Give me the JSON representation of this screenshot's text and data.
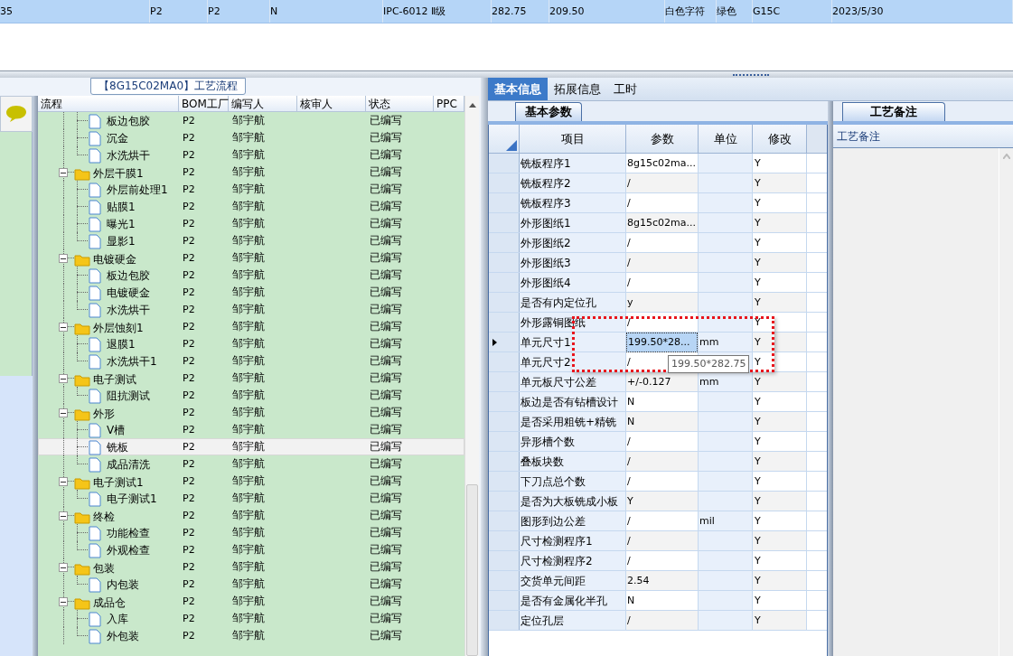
{
  "top_row": {
    "selected": true,
    "cells": [
      "35",
      "P2",
      "P2",
      "N",
      "IPC-6012 Ⅱ级",
      "282.75",
      "209.50",
      "白色字符",
      "绿色",
      "G15C",
      "2023/5/30"
    ]
  },
  "process": {
    "title": "【8G15C02MA0】工艺流程",
    "columns": [
      "流程",
      "BOM工厂",
      "编写人",
      "核审人",
      "状态",
      "PPC"
    ],
    "rows": [
      {
        "children": [
          {
            "name": "板边包胶",
            "bom": "P2",
            "author": "邹宇航",
            "status": "已编写",
            "selected": false
          },
          {
            "name": "沉金",
            "bom": "P2",
            "author": "邹宇航",
            "status": "已编写",
            "selected": false
          },
          {
            "name": "水洗烘干",
            "bom": "P2",
            "author": "邹宇航",
            "status": "已编写",
            "selected": false
          }
        ]
      },
      {
        "name": "外层干膜1",
        "bom": "P2",
        "author": "邹宇航",
        "status": "已编写",
        "selected": false,
        "expanded": true,
        "children": [
          {
            "name": "外层前处理1",
            "bom": "P2",
            "author": "邹宇航",
            "status": "已编写",
            "selected": false
          },
          {
            "name": "贴膜1",
            "bom": "P2",
            "author": "邹宇航",
            "status": "已编写",
            "selected": false
          },
          {
            "name": "曝光1",
            "bom": "P2",
            "author": "邹宇航",
            "status": "已编写",
            "selected": false
          },
          {
            "name": "显影1",
            "bom": "P2",
            "author": "邹宇航",
            "status": "已编写",
            "selected": false
          }
        ]
      },
      {
        "name": "电镀硬金",
        "bom": "P2",
        "author": "邹宇航",
        "status": "已编写",
        "selected": false,
        "expanded": true,
        "children": [
          {
            "name": "板边包胶",
            "bom": "P2",
            "author": "邹宇航",
            "status": "已编写",
            "selected": false
          },
          {
            "name": "电镀硬金",
            "bom": "P2",
            "author": "邹宇航",
            "status": "已编写",
            "selected": false
          },
          {
            "name": "水洗烘干",
            "bom": "P2",
            "author": "邹宇航",
            "status": "已编写",
            "selected": false
          }
        ]
      },
      {
        "name": "外层蚀刻1",
        "bom": "P2",
        "author": "邹宇航",
        "status": "已编写",
        "selected": false,
        "expanded": true,
        "children": [
          {
            "name": "退膜1",
            "bom": "P2",
            "author": "邹宇航",
            "status": "已编写",
            "selected": false
          },
          {
            "name": "水洗烘干1",
            "bom": "P2",
            "author": "邹宇航",
            "status": "已编写",
            "selected": false
          }
        ]
      },
      {
        "name": "电子测试",
        "bom": "P2",
        "author": "邹宇航",
        "status": "已编写",
        "selected": false,
        "expanded": true,
        "children": [
          {
            "name": "阻抗测试",
            "bom": "P2",
            "author": "邹宇航",
            "status": "已编写",
            "selected": false
          }
        ]
      },
      {
        "name": "外形",
        "bom": "P2",
        "author": "邹宇航",
        "status": "已编写",
        "selected": false,
        "expanded": true,
        "children": [
          {
            "name": "V槽",
            "bom": "P2",
            "author": "邹宇航",
            "status": "已编写",
            "selected": false
          },
          {
            "name": "铣板",
            "bom": "P2",
            "author": "邹宇航",
            "status": "已编写",
            "selected": true
          },
          {
            "name": "成品清洗",
            "bom": "P2",
            "author": "邹宇航",
            "status": "已编写",
            "selected": false
          }
        ]
      },
      {
        "name": "电子测试1",
        "bom": "P2",
        "author": "邹宇航",
        "status": "已编写",
        "selected": false,
        "expanded": true,
        "children": [
          {
            "name": "电子测试1",
            "bom": "P2",
            "author": "邹宇航",
            "status": "已编写",
            "selected": false
          }
        ]
      },
      {
        "name": "终检",
        "bom": "P2",
        "author": "邹宇航",
        "status": "已编写",
        "selected": false,
        "expanded": true,
        "children": [
          {
            "name": "功能检查",
            "bom": "P2",
            "author": "邹宇航",
            "status": "已编写",
            "selected": false
          },
          {
            "name": "外观检查",
            "bom": "P2",
            "author": "邹宇航",
            "status": "已编写",
            "selected": false
          }
        ]
      },
      {
        "name": "包装",
        "bom": "P2",
        "author": "邹宇航",
        "status": "已编写",
        "selected": false,
        "expanded": true,
        "children": [
          {
            "name": "内包装",
            "bom": "P2",
            "author": "邹宇航",
            "status": "已编写",
            "selected": false
          }
        ]
      },
      {
        "name": "成品仓",
        "bom": "P2",
        "author": "邹宇航",
        "status": "已编写",
        "selected": false,
        "expanded": true,
        "children": [
          {
            "name": "入库",
            "bom": "P2",
            "author": "邹宇航",
            "status": "已编写",
            "selected": false
          },
          {
            "name": "外包装",
            "bom": "P2",
            "author": "邹宇航",
            "status": "已编写",
            "selected": false
          }
        ]
      }
    ]
  },
  "tabs": [
    {
      "label": "基本信息",
      "selected": true
    },
    {
      "label": "拓展信息",
      "selected": false
    },
    {
      "label": "工时",
      "selected": false
    }
  ],
  "params": {
    "tab": "基本参数",
    "columns": [
      "项目",
      "参数",
      "单位",
      "修改"
    ],
    "rows": [
      {
        "item": "铣板程序1",
        "value": "8g15c02ma...",
        "unit": "",
        "modify": "Y",
        "selected": false
      },
      {
        "item": "铣板程序2",
        "value": "/",
        "unit": "",
        "modify": "Y",
        "selected": false
      },
      {
        "item": "铣板程序3",
        "value": "/",
        "unit": "",
        "modify": "Y",
        "selected": false
      },
      {
        "item": "外形图纸1",
        "value": "8g15c02ma...",
        "unit": "",
        "modify": "Y",
        "selected": false
      },
      {
        "item": "外形图纸2",
        "value": "/",
        "unit": "",
        "modify": "Y",
        "selected": false
      },
      {
        "item": "外形图纸3",
        "value": "/",
        "unit": "",
        "modify": "Y",
        "selected": false
      },
      {
        "item": "外形图纸4",
        "value": "/",
        "unit": "",
        "modify": "Y",
        "selected": false
      },
      {
        "item": "是否有内定位孔",
        "value": "y",
        "unit": "",
        "modify": "Y",
        "selected": false
      },
      {
        "item": "外形露铜图纸",
        "value": "/",
        "unit": "",
        "modify": "Y",
        "selected": false
      },
      {
        "item": "单元尺寸1",
        "value": "199.50*28...",
        "unit": "mm",
        "modify": "Y",
        "selected": true
      },
      {
        "item": "单元尺寸2",
        "value": "/",
        "unit": "",
        "modify": "Y",
        "selected": false
      },
      {
        "item": "单元板尺寸公差",
        "value": "+/-0.127",
        "unit": "mm",
        "modify": "Y",
        "selected": false
      },
      {
        "item": "板边是否有钻槽设计",
        "value": "N",
        "unit": "",
        "modify": "Y",
        "selected": false
      },
      {
        "item": "是否采用粗铣+精铣",
        "value": "N",
        "unit": "",
        "modify": "Y",
        "selected": false
      },
      {
        "item": "异形槽个数",
        "value": "/",
        "unit": "",
        "modify": "Y",
        "selected": false
      },
      {
        "item": "叠板块数",
        "value": "/",
        "unit": "",
        "modify": "Y",
        "selected": false
      },
      {
        "item": "下刀点总个数",
        "value": "/",
        "unit": "",
        "modify": "Y",
        "selected": false
      },
      {
        "item": "是否为大板铣成小板",
        "value": "Y",
        "unit": "",
        "modify": "Y",
        "selected": false
      },
      {
        "item": "图形到边公差",
        "value": "/",
        "unit": "mil",
        "modify": "Y",
        "selected": false
      },
      {
        "item": "尺寸检测程序1",
        "value": "/",
        "unit": "",
        "modify": "Y",
        "selected": false
      },
      {
        "item": "尺寸检测程序2",
        "value": "/",
        "unit": "",
        "modify": "Y",
        "selected": false
      },
      {
        "item": "交货单元间距",
        "value": "2.54",
        "unit": "",
        "modify": "Y",
        "selected": false
      },
      {
        "item": "是否有金属化半孔",
        "value": "N",
        "unit": "",
        "modify": "Y",
        "selected": false
      },
      {
        "item": "定位孔层",
        "value": "/",
        "unit": "",
        "modify": "Y",
        "selected": false
      }
    ],
    "tooltip": "199.50*282.75"
  },
  "notes": {
    "tab": "工艺备注",
    "header": "工艺备注"
  }
}
